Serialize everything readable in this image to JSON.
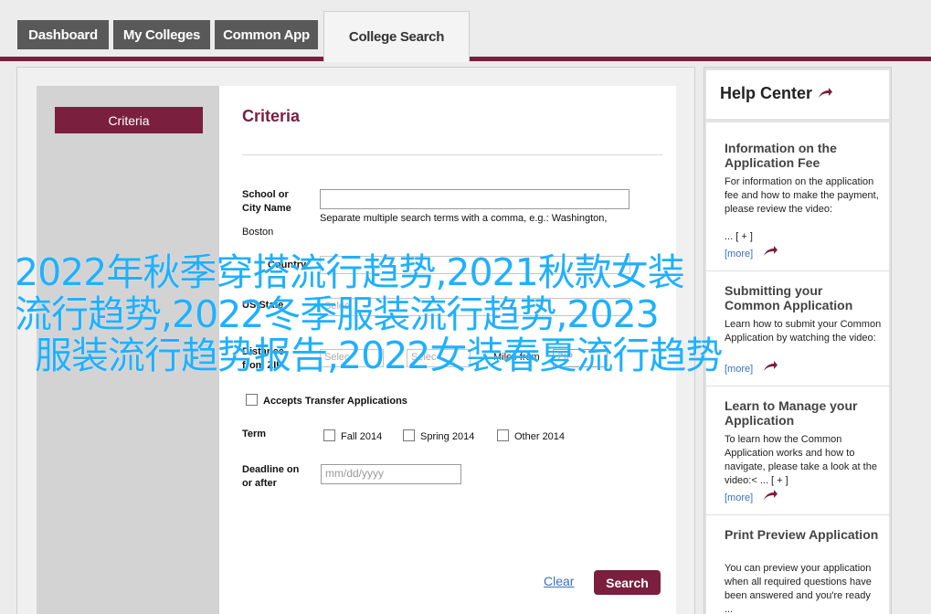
{
  "tabs": [
    {
      "label": "Dashboard"
    },
    {
      "label": "My Colleges"
    },
    {
      "label": "Common App"
    },
    {
      "label": "College Search"
    }
  ],
  "sidebar": {
    "criteria_label": "Criteria"
  },
  "form": {
    "title": "Criteria",
    "school_label_1": "School or",
    "school_label_2": "City Name",
    "school_value": "",
    "school_hint": "Separate multiple search terms with a comma, e.g.: Washington,",
    "boston_text": "Boston",
    "country_label": "Country",
    "us_state_label": "US State",
    "us_state_select": "Selec",
    "distance_label_1": "Distance",
    "distance_label_2": "from ZIP",
    "distance_select_1": "Selec",
    "distance_select_2": "Selec",
    "miles_label": "Miles from",
    "zip_placeholder": "ZIP",
    "transfer_label": "Accepts Transfer Applications",
    "term_label": "Term",
    "term_options": [
      "Fall 2014",
      "Spring 2014",
      "Other 2014"
    ],
    "deadline_label_1": "Deadline on",
    "deadline_label_2": "or after",
    "deadline_placeholder": "mm/dd/yyyy",
    "clear_label": "Clear",
    "search_label": "Search"
  },
  "help": {
    "title": "Help Center",
    "items": [
      {
        "heading": "Information on the Application Fee",
        "body": "For information on the application fee and how to make the payment, please review the video:",
        "expand": "... [ + ]",
        "more": "[more]"
      },
      {
        "heading": "Submitting your Common Application",
        "body": "Learn how to submit your Common Application by watching the video:",
        "expand": "",
        "more": "[more]"
      },
      {
        "heading": "Learn to Manage your Application",
        "body": "To learn how the Common Application works and how to navigate, please take a look at the video:< ... [ + ]",
        "expand": "",
        "more": "[more]"
      },
      {
        "heading": "Print Preview Application",
        "body": "You can preview your application when all required questions have been answered and you're ready ...",
        "expand": "",
        "more": ""
      }
    ]
  },
  "overlay": {
    "line1": "2022年秋季穿搭流行趋势,2021秋款女装",
    "line2": "流行趋势,2022冬季服装流行趋势,2023",
    "line3": "服装流行趋势报告,2022女装春夏流行趋势"
  },
  "colors": {
    "brand": "#7a1f3d",
    "link": "#3a6fc4",
    "overlay": "#1fb0ff"
  }
}
